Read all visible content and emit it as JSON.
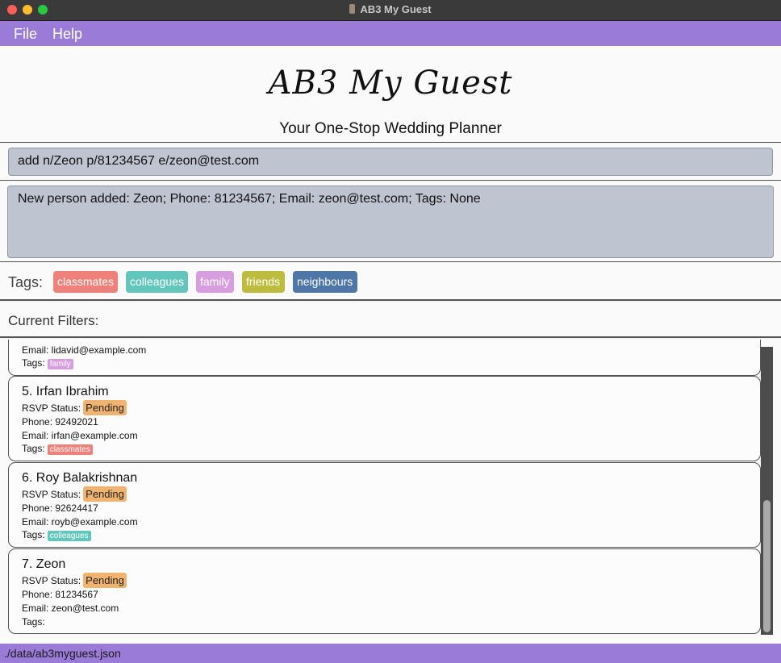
{
  "window": {
    "title": "AB3 My Guest"
  },
  "menu": {
    "file": "File",
    "help": "Help"
  },
  "header": {
    "logo": "AB3 My Guest",
    "subtitle": "Your One-Stop Wedding Planner"
  },
  "command": {
    "value": "add n/Zeon p/81234567 e/zeon@test.com"
  },
  "result": {
    "text": "New person added: Zeon; Phone: 81234567; Email: zeon@test.com; Tags: None"
  },
  "tags": {
    "label": "Tags:",
    "items": [
      {
        "label": "classmates",
        "color": "#f0807a"
      },
      {
        "label": "colleagues",
        "color": "#62c6bc"
      },
      {
        "label": "family",
        "color": "#d69edf"
      },
      {
        "label": "friends",
        "color": "#bebc3e"
      },
      {
        "label": "neighbours",
        "color": "#4e76a6"
      }
    ]
  },
  "filters": {
    "label": "Current Filters:"
  },
  "persons": [
    {
      "name": "",
      "rsvp_label": "",
      "rsvp": "",
      "phone": "",
      "email": "Email: lidavid@example.com",
      "tags_label": "Tags:",
      "tag": "family",
      "tag_color": "#d69edf"
    },
    {
      "name": "5. Irfan Ibrahim",
      "rsvp_label": "RSVP Status:",
      "rsvp": "Pending",
      "phone": "Phone: 92492021",
      "email": "Email: irfan@example.com",
      "tags_label": "Tags:",
      "tag": "classmates",
      "tag_color": "#f0807a"
    },
    {
      "name": "6. Roy Balakrishnan",
      "rsvp_label": "RSVP Status:",
      "rsvp": "Pending",
      "phone": "Phone: 92624417",
      "email": "Email: royb@example.com",
      "tags_label": "Tags:",
      "tag": "colleagues",
      "tag_color": "#62c6bc"
    },
    {
      "name": "7. Zeon",
      "rsvp_label": "RSVP Status:",
      "rsvp": "Pending",
      "phone": "Phone: 81234567",
      "email": "Email: zeon@test.com",
      "tags_label": "Tags:",
      "tag": "",
      "tag_color": ""
    }
  ],
  "status": {
    "path": "./data/ab3myguest.json"
  },
  "colors": {
    "accent": "#9b7bd8",
    "box": "#bec4d0",
    "pending": "#f0b470"
  }
}
